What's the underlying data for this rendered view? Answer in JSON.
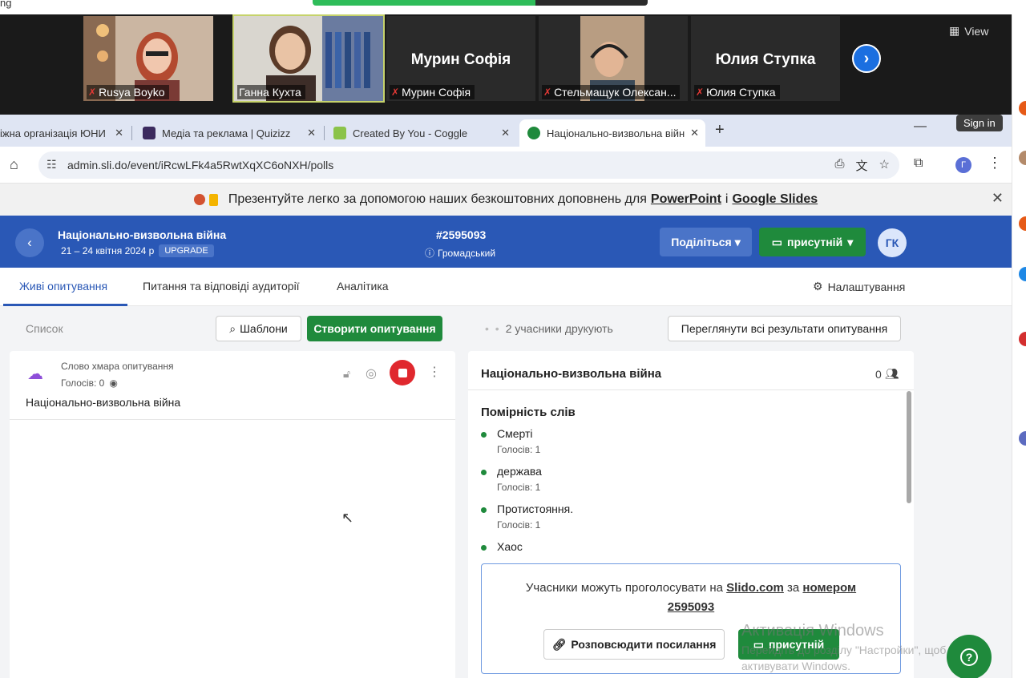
{
  "top_strip": {
    "cut_text": "ng"
  },
  "zoom": {
    "view_label": "View",
    "participants": [
      {
        "name": "Rusya Boyko"
      },
      {
        "name": "Ганна Кухта"
      },
      {
        "name": "Мурин Софія",
        "display": "Мурин Софія"
      },
      {
        "name": "Стельмащук Олексан..."
      },
      {
        "name": "Юлия Ступка",
        "display": "Юлия Ступка"
      }
    ]
  },
  "browser": {
    "tabs": [
      {
        "label": "іжна організація ЮНИ"
      },
      {
        "label": "Медіа та реклама | Quizizz"
      },
      {
        "label": "Created By You - Coggle"
      },
      {
        "label": "Національно-визвольна війн"
      }
    ],
    "sign_in": "Sign in",
    "url": "admin.sli.do/event/iRcwLFk4a5RwtXqXC6oNXH/polls",
    "profile_initial": "Г"
  },
  "banner": {
    "text": "Презентуйте легко за допомогою наших безкоштовних доповнень для",
    "powerpoint": "PowerPoint",
    "and": "і",
    "slides": "Google Slides"
  },
  "header": {
    "event_title": "Національно-визвольна війна",
    "dates": "21 – 24 квітня 2024 р",
    "upgrade": "UPGRADE",
    "code": "#2595093",
    "visibility": "Громадський",
    "share": "Поділіться",
    "present": "присутній",
    "avatar": "ГК"
  },
  "nav": {
    "tabs": [
      "Живі опитування",
      "Питання та відповіді аудиторії",
      "Аналітика"
    ],
    "settings": "Налаштування"
  },
  "toolbar": {
    "list": "Список",
    "templates": "Шаблони",
    "create": "Створити опитування",
    "typing": "2 учасники друкують",
    "view_all": "Переглянути всі результати опитування"
  },
  "poll": {
    "type": "Слово хмара опитування",
    "votes": "Голосів: 0",
    "title": "Національно-визвольна війна"
  },
  "results": {
    "title": "Національно-визвольна війна",
    "count": "0",
    "section": "Помірність слів",
    "words": [
      {
        "text": "Смерті",
        "votes": "Голосів: 1"
      },
      {
        "text": "держава",
        "votes": "Голосів: 1"
      },
      {
        "text": "Протистояння.",
        "votes": "Голосів: 1"
      },
      {
        "text": "Хаос",
        "votes": ""
      }
    ],
    "join": {
      "prefix": "Учасники можуть проголосувати на",
      "site": "Slido.com",
      "middle": "за",
      "number_label": "номером",
      "number": "2595093"
    },
    "share_link": "Розповсюдити посилання",
    "present": "присутній"
  },
  "os": {
    "watermark_title": "Активація Windows",
    "watermark_sub": "Перейдіть до розділу \"Настройки\", щоб активувати Windows."
  }
}
